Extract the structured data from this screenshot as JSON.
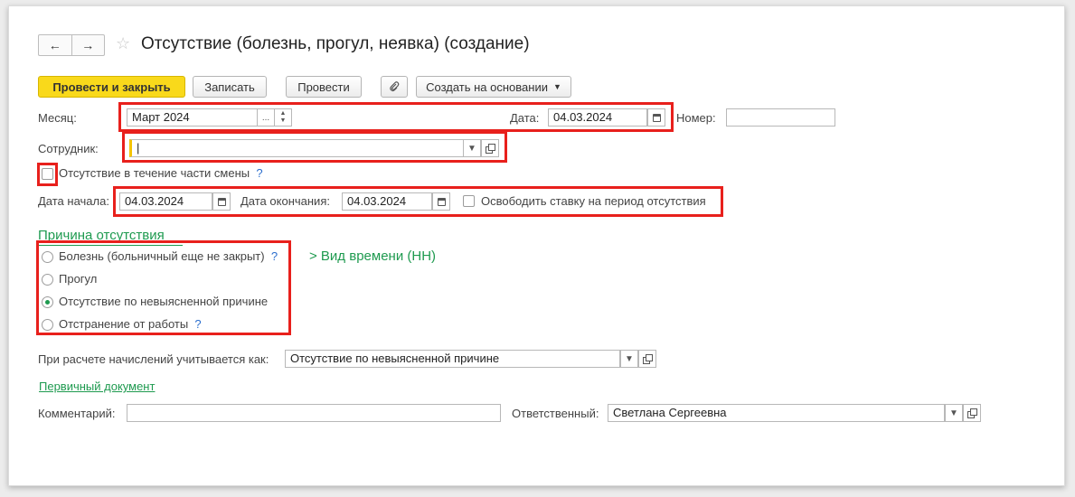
{
  "header": {
    "back_icon": "←",
    "forward_icon": "→",
    "favorite_icon": "☆",
    "title": "Отсутствие (болезнь, прогул, неявка) (создание)"
  },
  "toolbar": {
    "post_close": "Провести и закрыть",
    "save": "Записать",
    "post": "Провести",
    "attach_icon": "paperclip-icon",
    "create_based": "Создать на основании"
  },
  "form": {
    "month_label": "Месяц:",
    "month_value": "Март 2024",
    "month_dots": "...",
    "date_label": "Дата:",
    "date_value": "04.03.2024",
    "number_label": "Номер:",
    "number_value": "",
    "employee_label": "Сотрудник:",
    "employee_value": "|",
    "partial_shift_label": "Отсутствие в течение части смены",
    "partial_shift_checked": false,
    "help": "?",
    "start_label": "Дата начала:",
    "start_value": "04.03.2024",
    "end_label": "Дата окончания:",
    "end_value": "04.03.2024",
    "release_rate_label": "Освободить ставку на период отсутствия",
    "release_rate_checked": false
  },
  "reason": {
    "title": "Причина отсутствия",
    "options": [
      {
        "label": "Болезнь (больничный еще не закрыт)",
        "selected": false
      },
      {
        "label": "Прогул",
        "selected": false
      },
      {
        "label": "Отсутствие по невыясненной причине",
        "selected": true
      },
      {
        "label": "Отстранение от работы",
        "selected": false
      }
    ],
    "time_kind": "> Вид времени (НН)"
  },
  "accrual": {
    "label": "При расчете начислений учитывается как:",
    "value": "Отсутствие по невыясненной причине"
  },
  "primary_doc_link": "Первичный документ",
  "comment": {
    "label": "Комментарий:",
    "value": ""
  },
  "responsible": {
    "label": "Ответственный:",
    "value": "Светлана Сергеевна"
  },
  "colors": {
    "primary_button": "#f9d91b",
    "highlight": "#e8201c",
    "green": "#1e9a4f",
    "help": "#2c6fce"
  }
}
